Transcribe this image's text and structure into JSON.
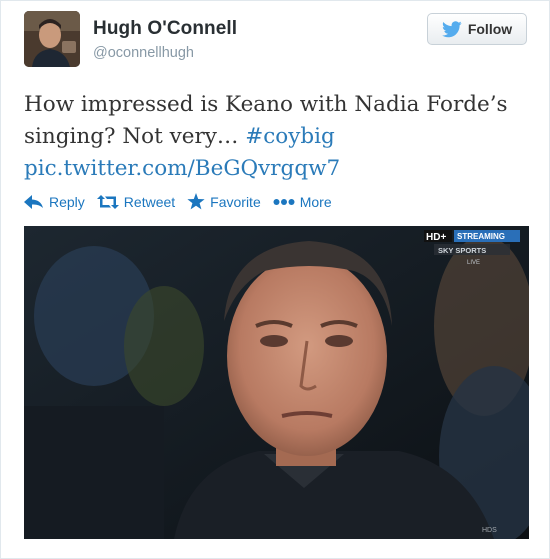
{
  "user": {
    "name": "Hugh O'Connell",
    "handle": "@oconnellhugh",
    "avatar_icon": "avatar-photo"
  },
  "follow_button": {
    "label": "Follow",
    "icon": "twitter-bird-icon",
    "color": "#55acee"
  },
  "tweet": {
    "text_before": "How impressed is Keano with Nadia Forde’s singing? Not very… ",
    "hashtag": "#coybig",
    "link": "pic.twitter.com/BeGQvrgqw7"
  },
  "actions": [
    {
      "label": "Reply",
      "icon": "reply-icon"
    },
    {
      "label": "Retweet",
      "icon": "retweet-icon"
    },
    {
      "label": "Favorite",
      "icon": "star-icon"
    },
    {
      "label": "More",
      "icon": "more-dots-icon"
    }
  ],
  "media": {
    "badge_hd": "HD+",
    "badge_streaming": "STREAMING",
    "broadcaster": "SKY SPORTS",
    "live": "LIVE",
    "corner_mark": "HDS",
    "accent": "#1b76bf"
  }
}
